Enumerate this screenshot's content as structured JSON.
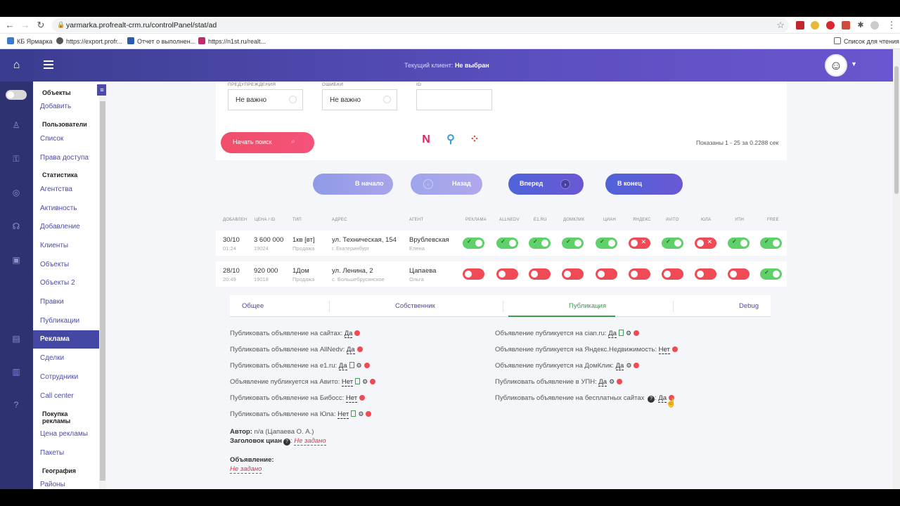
{
  "browser": {
    "url": "yarmarka.profrealt-crm.ru/controlPanel/stat/ad",
    "bookmarks": [
      "КБ Ярмарка",
      "https://export.profr...",
      "Отчет о выполнен...",
      "https://n1st.ru/realt..."
    ],
    "reading_list": "Список для чтения"
  },
  "header": {
    "client_label": "Текущий клиент:",
    "client_value": "Не выбран"
  },
  "menu": {
    "objects_heading": "Объекты",
    "add": "Добавить",
    "users_heading": "Пользователи",
    "list": "Список",
    "access": "Права доступа",
    "stats_heading": "Статистика",
    "agencies": "Агентства",
    "activity": "Активность",
    "adding": "Добавление",
    "clients": "Клиенты",
    "objects": "Объекты",
    "objects2": "Объекты 2",
    "edits": "Правки",
    "publications": "Публикации",
    "ads": "Реклама",
    "deals": "Сделки",
    "staff": "Сотрудники",
    "callcenter": "Call center",
    "buying_heading": "Покупка рекламы",
    "price": "Цена рекламы",
    "packages": "Пакеты",
    "geo_heading": "География",
    "districts": "Районы"
  },
  "filters": {
    "warnings_label": "ПРЕДУПРЕЖДЕНИЯ",
    "warnings_value": "Не важно",
    "errors_label": "ОШИБКИ",
    "errors_value": "Не важно",
    "id_label": "ID",
    "search_button": "Начать поиск",
    "shown": "Показаны 1 - 25 за 0.2288 сек"
  },
  "pager": {
    "first": "В начало",
    "back": "Назад",
    "forward": "Вперед",
    "last": "В конец"
  },
  "table": {
    "headers": [
      "ДОБАВЛЕН",
      "ЦЕНА / ID",
      "ТИП",
      "АДРЕС",
      "АГЕНТ",
      "РЕКЛАМА",
      "ALLNEDV",
      "E1.RU",
      "ДОМКЛИК",
      "ЦИАН",
      "ЯНДЕКС",
      "AVITO",
      "ЮЛА",
      "УПН",
      "FREE"
    ],
    "rows": [
      {
        "date": "30/10",
        "time": "01:24",
        "price": "3 600 000",
        "id": "19024",
        "type": "1кв [вт]",
        "deal": "Продажа",
        "address": "ул. Техническая, 154",
        "city": "г. Екатеринбург",
        "agent": "Врублевская",
        "agent_name": "Елена",
        "toggles": [
          true,
          true,
          true,
          true,
          true,
          false,
          true,
          false,
          true,
          true
        ]
      },
      {
        "date": "28/10",
        "time": "20:49",
        "price": "920 000",
        "id": "19018",
        "type": "1Дом",
        "deal": "Продажа",
        "address": "ул. Ленина, 2",
        "city": "с. Большебрусянское",
        "agent": "Цапаева",
        "agent_name": "Ольга",
        "toggles": [
          false,
          false,
          false,
          false,
          false,
          false,
          false,
          false,
          false,
          true
        ]
      }
    ]
  },
  "tabs": [
    "Общее",
    "Собственник",
    "Публикация",
    "Debug"
  ],
  "publication": {
    "left": [
      {
        "text": "Публиковать объявление на сайтах:",
        "value": "Да"
      },
      {
        "text": "Публиковать объявление на AllNedv:",
        "value": "Да"
      },
      {
        "text": "Публиковать объявление на e1.ru:",
        "value": "Да"
      },
      {
        "text": "Объявление публикуется на Авито:",
        "value": "Нет"
      },
      {
        "text": "Публиковать объявление на Бибосс:",
        "value": "Нет"
      },
      {
        "text": "Публиковать объявление на Юла:",
        "value": "Нет"
      }
    ],
    "right": [
      {
        "text": "Объявление публикуется на cian.ru:",
        "value": "Да"
      },
      {
        "text": "Объявление публикуется на Яндекс.Недвижимость:",
        "value": "Нет"
      },
      {
        "text": "Объявление публикуется на ДомКлик:",
        "value": "Да"
      },
      {
        "text": "Публиковать объявление в УПН:",
        "value": "Да"
      },
      {
        "text": "Публиковать объявление на бесплатных сайтах",
        "value": "Да"
      }
    ],
    "author_label": "Автор:",
    "author_value": "n/a (Цапаева О. А.)",
    "cian_title_label": "Заголовок циан",
    "cian_title_value": "Не задано",
    "ad_label": "Объявление:",
    "ad_value": "Не задано"
  }
}
